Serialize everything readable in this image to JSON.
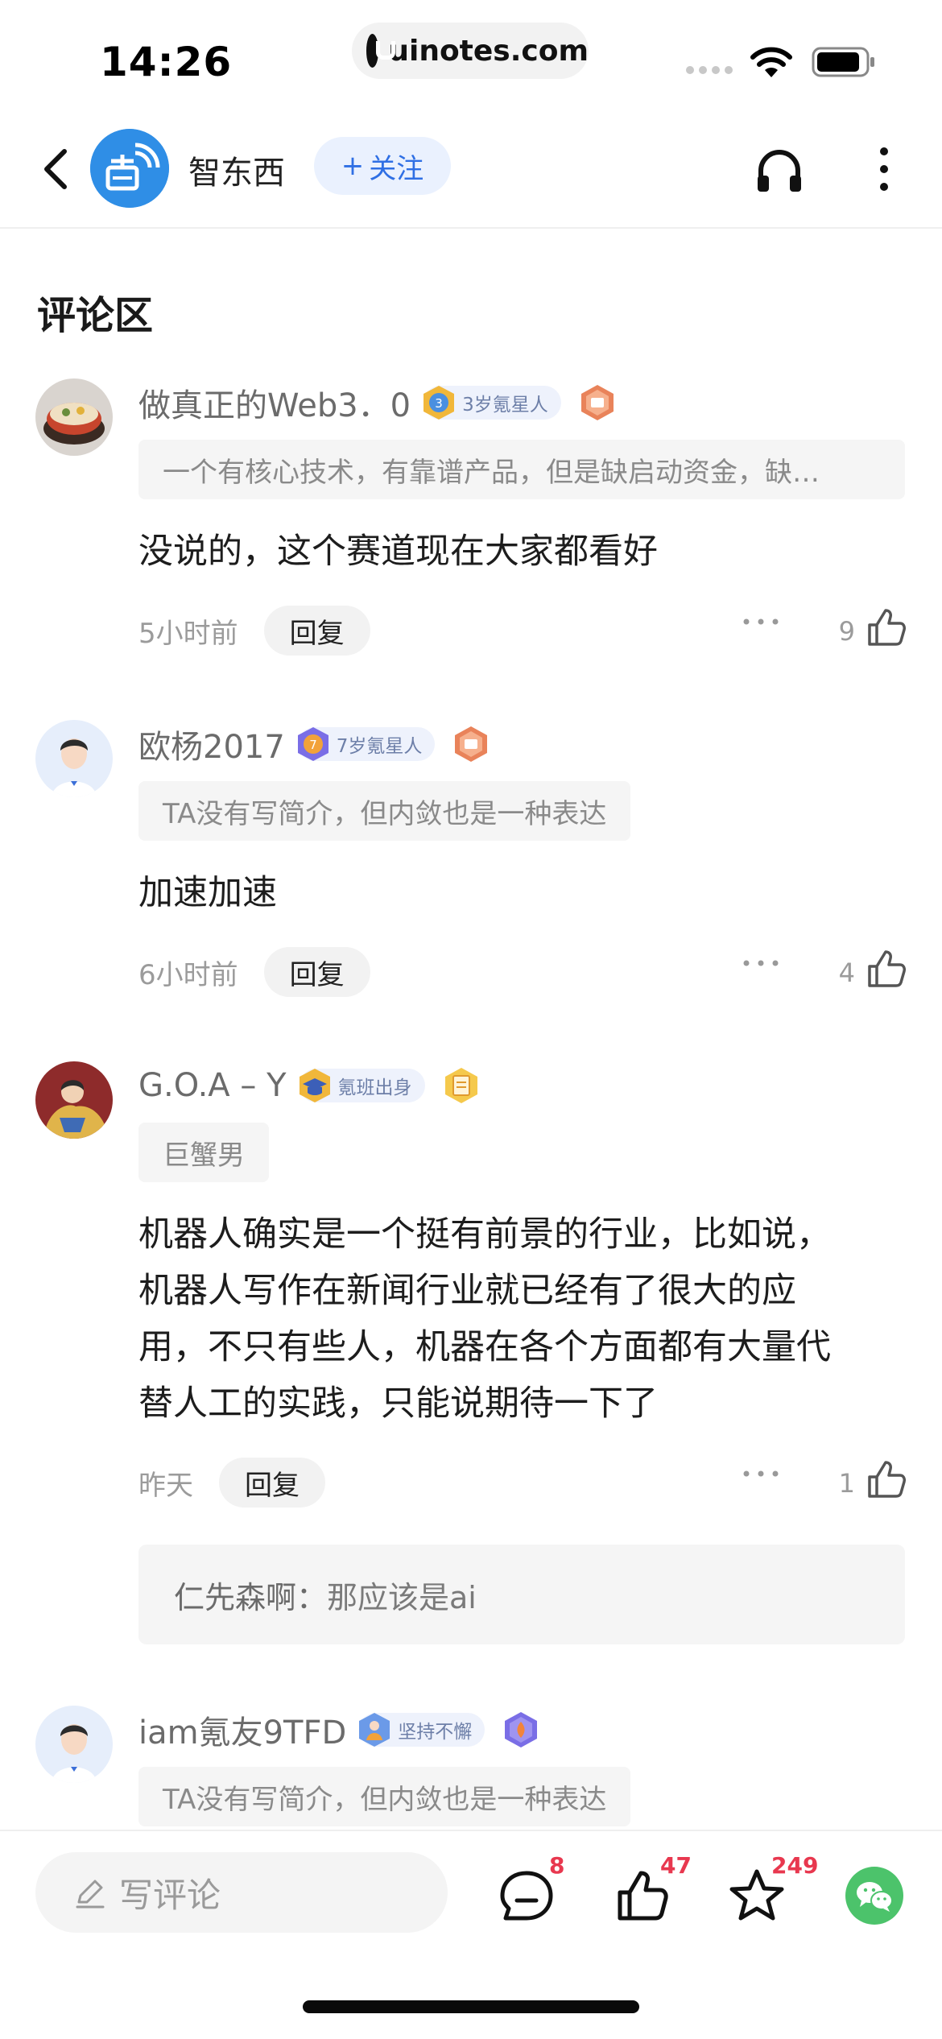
{
  "status_bar": {
    "time": "14:26",
    "url": "uinotes.com"
  },
  "header": {
    "source_name": "智东西",
    "follow_label": "关注",
    "follow_prefix": "+"
  },
  "section_title": "评论区",
  "comments": [
    {
      "name": "做真正的Web3．0",
      "badge": "3岁氪星人",
      "bio": "一个有核心技术，有靠谱产品，但是缺启动资金，缺…",
      "text": "没说的，这个赛道现在大家都看好",
      "time": "5小时前",
      "reply_label": "回复",
      "likes": "9"
    },
    {
      "name": "欧杨2017",
      "badge": "7岁氪星人",
      "bio": "TA没有写简介，但内敛也是一种表达",
      "text": "加速加速",
      "time": "6小时前",
      "reply_label": "回复",
      "likes": "4"
    },
    {
      "name": "G.O.A – Y",
      "badge": "氪班出身",
      "bio": "巨蟹男",
      "text_lines": [
        "机器人确实是一个挺有前景的行业，比如说，",
        "机器人写作在新闻行业就已经有了很大的应",
        "用，不只有些人，机器在各个方面都有大量代",
        "替人工的实践，只能说期待一下了"
      ],
      "time": "昨天",
      "reply_label": "回复",
      "likes": "1",
      "sub_reply": {
        "author": "仁先森啊：",
        "text": "那应该是ai"
      }
    },
    {
      "name": "iam氪友9TFD",
      "badge": "坚持不懈",
      "bio": "TA没有写简介，但内敛也是一种表达"
    }
  ],
  "bottom_bar": {
    "write_placeholder": "写评论",
    "comment_count": "8",
    "like_count": "47",
    "favorite_count": "249"
  },
  "colors": {
    "accent": "#2f6fe4",
    "badge_red": "#e8384f",
    "wechat": "#4cc36b"
  }
}
